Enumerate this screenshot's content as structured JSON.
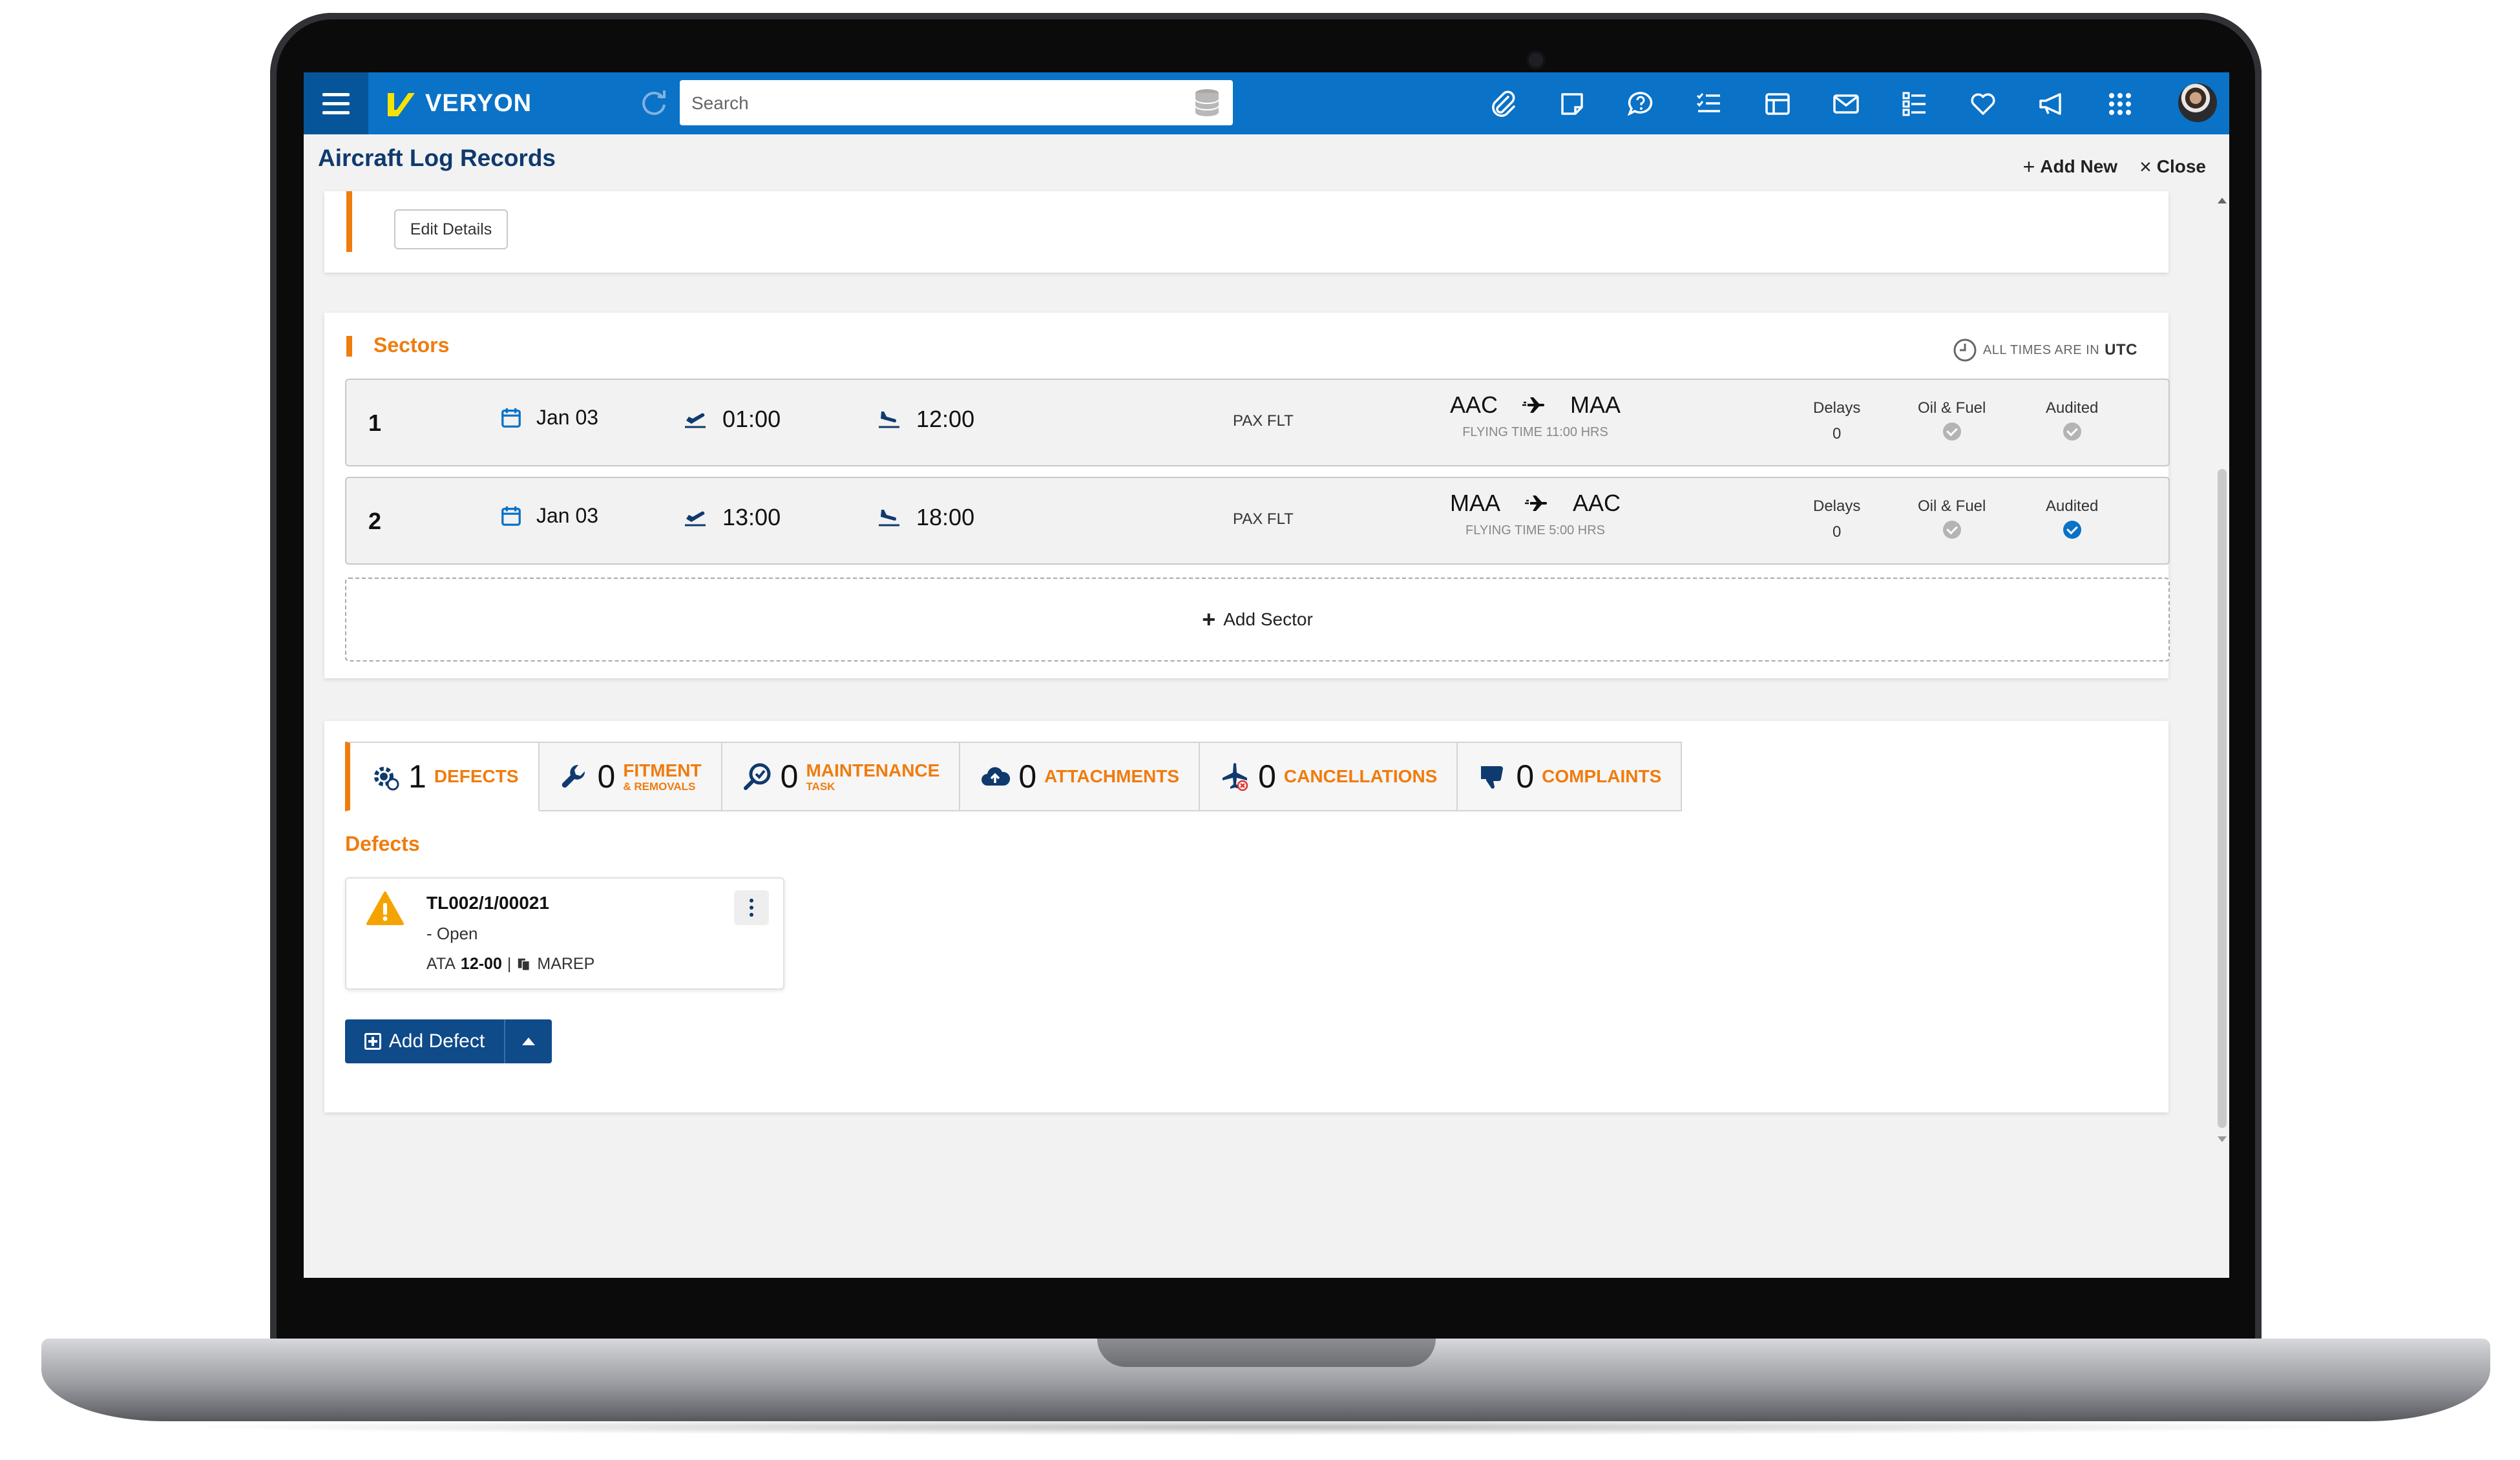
{
  "app": {
    "brand": "VERYON",
    "search": {
      "placeholder": "Search"
    },
    "toolbar_icons": [
      "paperclip-icon",
      "sticky-note-icon",
      "help-chat-icon",
      "checklist-icon",
      "layout-icon",
      "mail-icon",
      "list-settings-icon",
      "heart-icon",
      "megaphone-icon",
      "apps-grid-icon"
    ]
  },
  "header": {
    "title": "Aircraft Log Records",
    "add_new": "Add New",
    "close": "Close"
  },
  "details": {
    "edit_button": "Edit Details"
  },
  "sectors": {
    "title": "Sectors",
    "utc_prefix": "All times are in",
    "utc_value": "UTC",
    "rows": [
      {
        "num": "1",
        "date": "Jan 03",
        "dep": "01:00",
        "arr": "12:00",
        "type": "PAX FLT",
        "from": "AAC",
        "to": "MAA",
        "flying_time": "FLYING TIME 11:00 HRS",
        "delays_label": "Delays",
        "delays": "0",
        "oil_label": "Oil & Fuel",
        "audited_label": "Audited",
        "oil_checked": false,
        "audited_checked": false
      },
      {
        "num": "2",
        "date": "Jan 03",
        "dep": "13:00",
        "arr": "18:00",
        "type": "PAX FLT",
        "from": "MAA",
        "to": "AAC",
        "flying_time": "FLYING TIME 5:00 HRS",
        "delays_label": "Delays",
        "delays": "0",
        "oil_label": "Oil & Fuel",
        "audited_label": "Audited",
        "oil_checked": false,
        "audited_checked": true
      }
    ],
    "add_sector": "Add Sector"
  },
  "tabs": [
    {
      "count": "1",
      "label": "DEFECTS",
      "sub": ""
    },
    {
      "count": "0",
      "label": "FITMENT",
      "sub": "& REMOVALS"
    },
    {
      "count": "0",
      "label": "MAINTENANCE",
      "sub": "TASK"
    },
    {
      "count": "0",
      "label": "ATTACHMENTS",
      "sub": ""
    },
    {
      "count": "0",
      "label": "CANCELLATIONS",
      "sub": ""
    },
    {
      "count": "0",
      "label": "COMPLAINTS",
      "sub": ""
    }
  ],
  "defects": {
    "title": "Defects",
    "items": [
      {
        "id": "TL002/1/00021",
        "status": "- Open",
        "ata_label": "ATA",
        "ata_value": "12-00",
        "separator": "|",
        "type": "MAREP"
      }
    ],
    "add_button": "Add Defect"
  },
  "colors": {
    "primary": "#0a72c7",
    "accent": "#f07c0e",
    "navy": "#0f4a89"
  }
}
